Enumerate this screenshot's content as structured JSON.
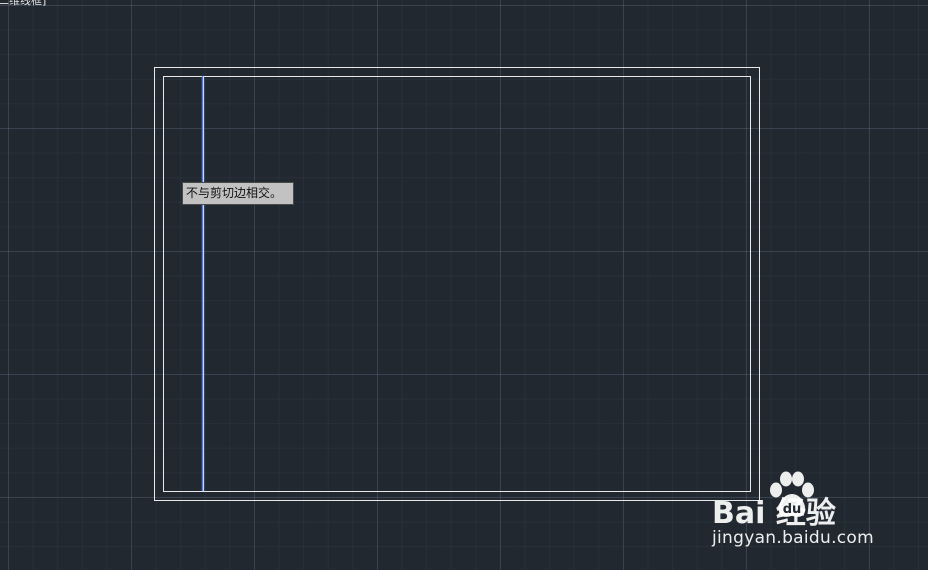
{
  "viewport": {
    "label": "二维线框]"
  },
  "tooltip": {
    "text": "不与剪切边相交。"
  },
  "watermark": {
    "brand": "Bai   经验",
    "url": "jingyan.baidu.com",
    "logo_icon": "baidu-paw-icon"
  },
  "colors": {
    "background": "#212830",
    "rectangle_lines": "#e8e8e8",
    "selected_line": "#4a7cff",
    "tooltip_bg": "#c2c2c2"
  }
}
